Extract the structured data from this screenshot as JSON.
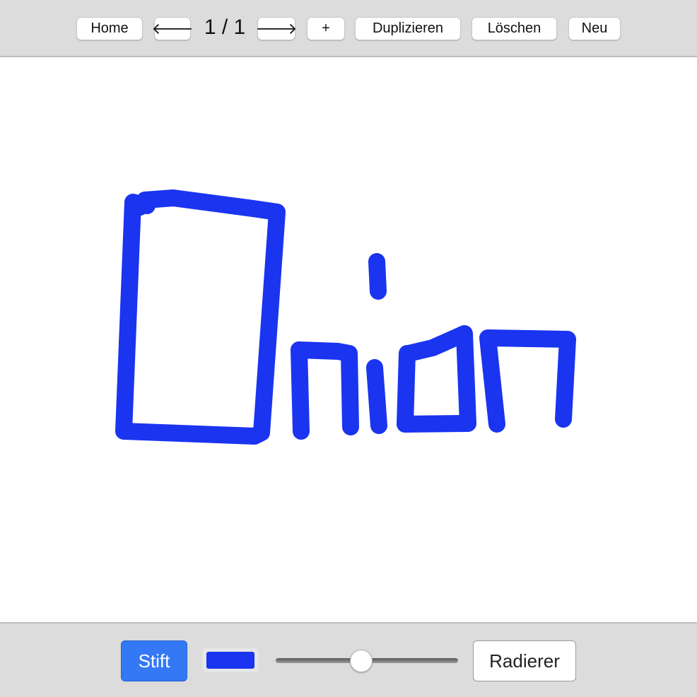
{
  "toolbar": {
    "home_label": "Home",
    "prev_label": "🡐",
    "page_indicator": "1 / 1",
    "next_label": "🡒",
    "add_label": "+",
    "duplicate_label": "Duplizieren",
    "delete_label": "Löschen",
    "new_label": "Neu"
  },
  "canvas": {
    "stroke_color": "#1a34f0",
    "drawn_text": "Onion"
  },
  "tools": {
    "pen_label": "Stift",
    "pen_active": true,
    "color_value": "#1a34f0",
    "size_level": 0.47,
    "eraser_label": "Radierer"
  }
}
